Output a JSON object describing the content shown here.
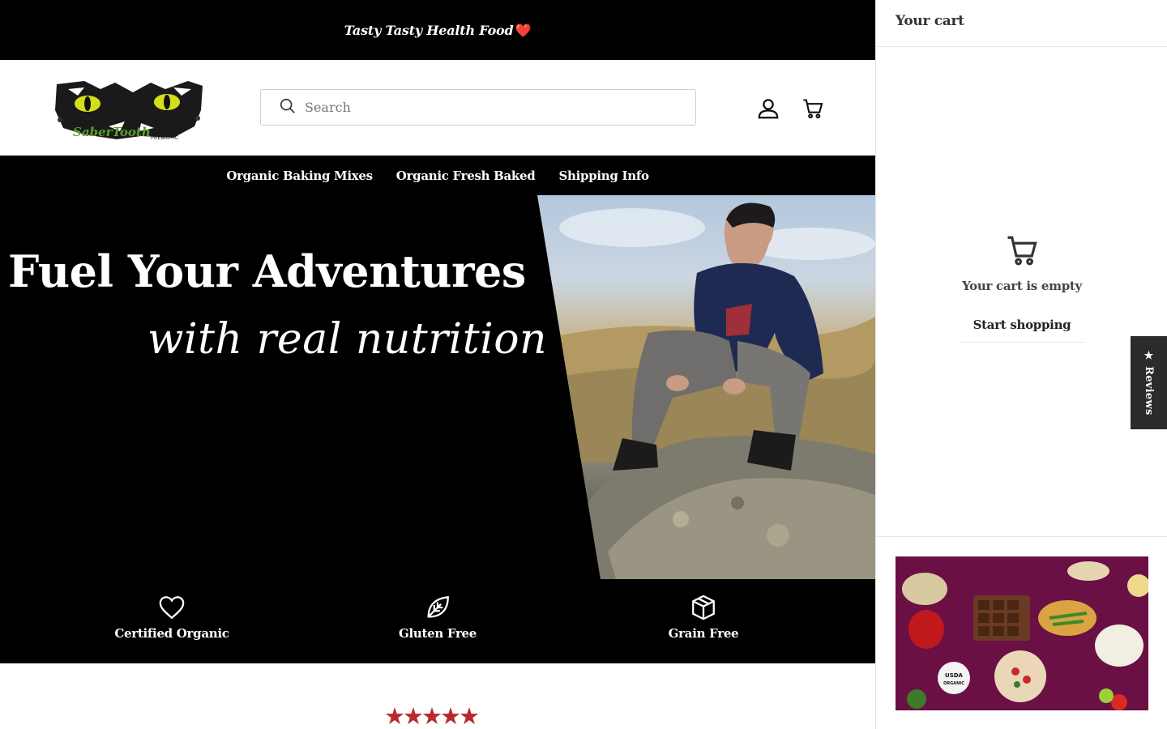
{
  "announcement": {
    "text": "Tasty Tasty Health Food",
    "heart": "❤️"
  },
  "header": {
    "logo_text": "SaberTooth",
    "logo_subtext": "PREBIOTIC",
    "search_placeholder": "Search",
    "icons": [
      "search-icon",
      "account-icon",
      "cart-icon"
    ]
  },
  "nav": {
    "items": [
      {
        "label": "Organic Baking Mixes"
      },
      {
        "label": "Organic Fresh Baked"
      },
      {
        "label": "Shipping Info"
      }
    ]
  },
  "hero": {
    "title": "Fuel Your Adventures",
    "subtitle": "with real nutrition"
  },
  "features": [
    {
      "label": "Certified Organic",
      "icon": "heart-icon"
    },
    {
      "label": "Gluten Free",
      "icon": "leaf-icon"
    },
    {
      "label": "Grain Free",
      "icon": "box-icon"
    }
  ],
  "rating": {
    "stars": "★★★★★"
  },
  "cart": {
    "title": "Your cart",
    "empty_message": "Your cart is empty",
    "start_shopping": "Start shopping",
    "promo_badge_line1": "USDA",
    "promo_badge_line2": "ORGANIC"
  },
  "reviews_tab": {
    "label": "★ Reviews"
  },
  "colors": {
    "accent_black": "#000000",
    "star_red": "#b8292f",
    "heart_red": "#e0222b"
  }
}
